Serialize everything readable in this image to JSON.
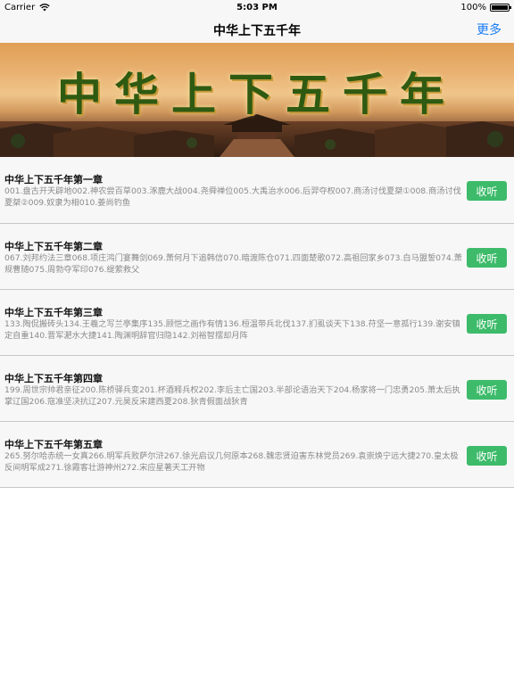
{
  "status_bar": {
    "carrier": "Carrier",
    "time": "5:03 PM",
    "battery_text": "100%",
    "battery_level": 1.0
  },
  "nav": {
    "title": "中华上下五千年",
    "more_label": "更多"
  },
  "banner": {
    "title": "中华上下五千年"
  },
  "chapters": [
    {
      "title": "中华上下五千年第一章",
      "desc": "001.盘古开天辟地002.神农尝百草003.涿鹿大战004.尧舜禅位005.大禹治水006.后羿夺权007.商汤讨伐夏桀①008.商汤讨伐夏桀②009.奴隶为相010.姜尚钓鱼",
      "button": "收听"
    },
    {
      "title": "中华上下五千年第二章",
      "desc": "067.刘邦约法三章068.项庄鸿门宴舞剑069.萧何月下追韩信070.暗渡陈仓071.四面楚歌072.高祖回家乡073.白马盟誓074.萧规曹随075.周勃夺军印076.缇萦救父",
      "button": "收听"
    },
    {
      "title": "中华上下五千年第三章",
      "desc": "133.陶侃搬砖头134.王羲之写兰亭集序135.顾恺之画作有情136.桓温带兵北伐137.扪虱谈天下138.苻坚一意孤行139.谢安镇定自重140.晋军淝水大捷141.陶渊明辞官归隐142.刘裕智摆却月阵",
      "button": "收听"
    },
    {
      "title": "中华上下五千年第四章",
      "desc": "199.周世宗帅君亲征200.陈桥驿兵变201.杯酒释兵权202.李后主亡国203.半部论语治天下204.杨家将一门忠勇205.萧太后执掌辽国206.寇准坚决抗辽207.元昊反宋建西夏208.狄青假面战狄青",
      "button": "收听"
    },
    {
      "title": "中华上下五千年第五章",
      "desc": "265.努尔哈赤统一女真266.明军兵败萨尔浒267.徐光启议几何原本268.魏忠贤迫害东林党员269.袁崇焕宁远大捷270.皇太极反间明军成271.徐霞客壮游神州272.宋应星著天工开物",
      "button": "收听"
    }
  ]
}
